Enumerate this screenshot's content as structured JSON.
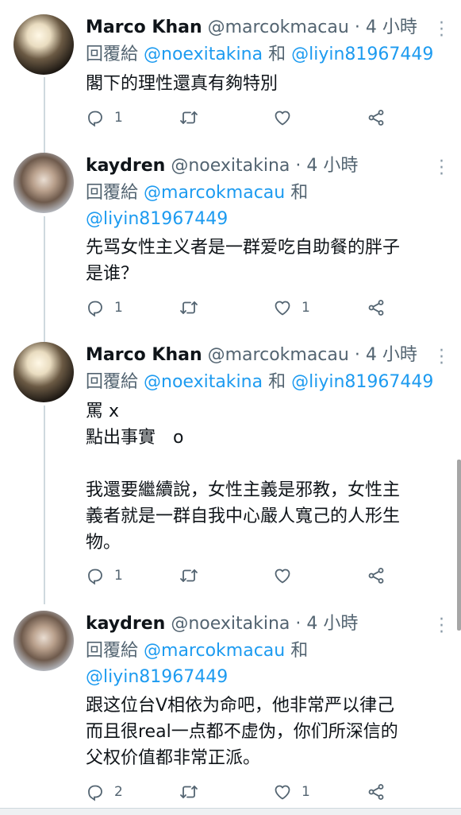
{
  "reply_prefix": "回覆給",
  "conjunction": "和",
  "tweets": [
    {
      "name": "Marco Khan",
      "handle": "@marcokmacau",
      "dot": "·",
      "time": "4 小時",
      "reply_to": [
        "@noexitakina",
        "@liyin81967449"
      ],
      "text": "閣下的理性還真有夠特別",
      "counts": {
        "reply": "1",
        "retweet": "",
        "like": ""
      }
    },
    {
      "name": "kaydren",
      "handle": "@noexitakina",
      "dot": "·",
      "time": "4 小時",
      "reply_to": [
        "@marcokmacau",
        "@liyin81967449"
      ],
      "text": "先骂女性主义者是一群爱吃自助餐的胖子\n是谁？",
      "counts": {
        "reply": "1",
        "retweet": "",
        "like": "1"
      }
    },
    {
      "name": "Marco Khan",
      "handle": "@marcokmacau",
      "dot": "·",
      "time": "4 小時",
      "reply_to": [
        "@noexitakina",
        "@liyin81967449"
      ],
      "text": "罵 x\n點出事實　o\n\n我還要繼續說，女性主義是邪教，女性主\n義者就是一群自我中心嚴人寬己的人形生\n物。",
      "counts": {
        "reply": "1",
        "retweet": "",
        "like": ""
      }
    },
    {
      "name": "kaydren",
      "handle": "@noexitakina",
      "dot": "·",
      "time": "4 小時",
      "reply_to": [
        "@marcokmacau",
        "@liyin81967449"
      ],
      "text": "跟这位台V相依为命吧，他非常严以律己\n而且很real一点都不虚伪，你们所深信的\n父权价值都非常正派。",
      "counts": {
        "reply": "2",
        "retweet": "",
        "like": "1"
      }
    }
  ],
  "icons": [
    "more-vertical-icon",
    "reply-icon",
    "retweet-icon",
    "like-icon",
    "share-icon"
  ],
  "colors": {
    "link": "#1d9bf0",
    "secondary": "#536471",
    "text": "#0f1419",
    "thread_line": "#cfd9de"
  }
}
